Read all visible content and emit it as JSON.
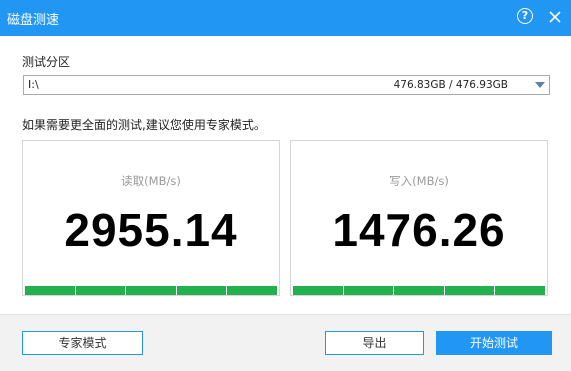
{
  "window": {
    "title": "磁盘测速"
  },
  "partition": {
    "label": "测试分区",
    "drive": "I:\\",
    "capacity": "476.83GB / 476.93GB"
  },
  "hint": "如果需要更全面的测试,建议您使用专家模式。",
  "read": {
    "label": "读取(MB/s)",
    "value": "2955.14",
    "progress": 1.0
  },
  "write": {
    "label": "写入(MB/s)",
    "value": "1476.26",
    "progress": 1.0
  },
  "buttons": {
    "expert": "专家模式",
    "export": "导出",
    "start": "开始测试"
  },
  "colors": {
    "accent": "#2196f3",
    "progress": "#22b14c"
  }
}
